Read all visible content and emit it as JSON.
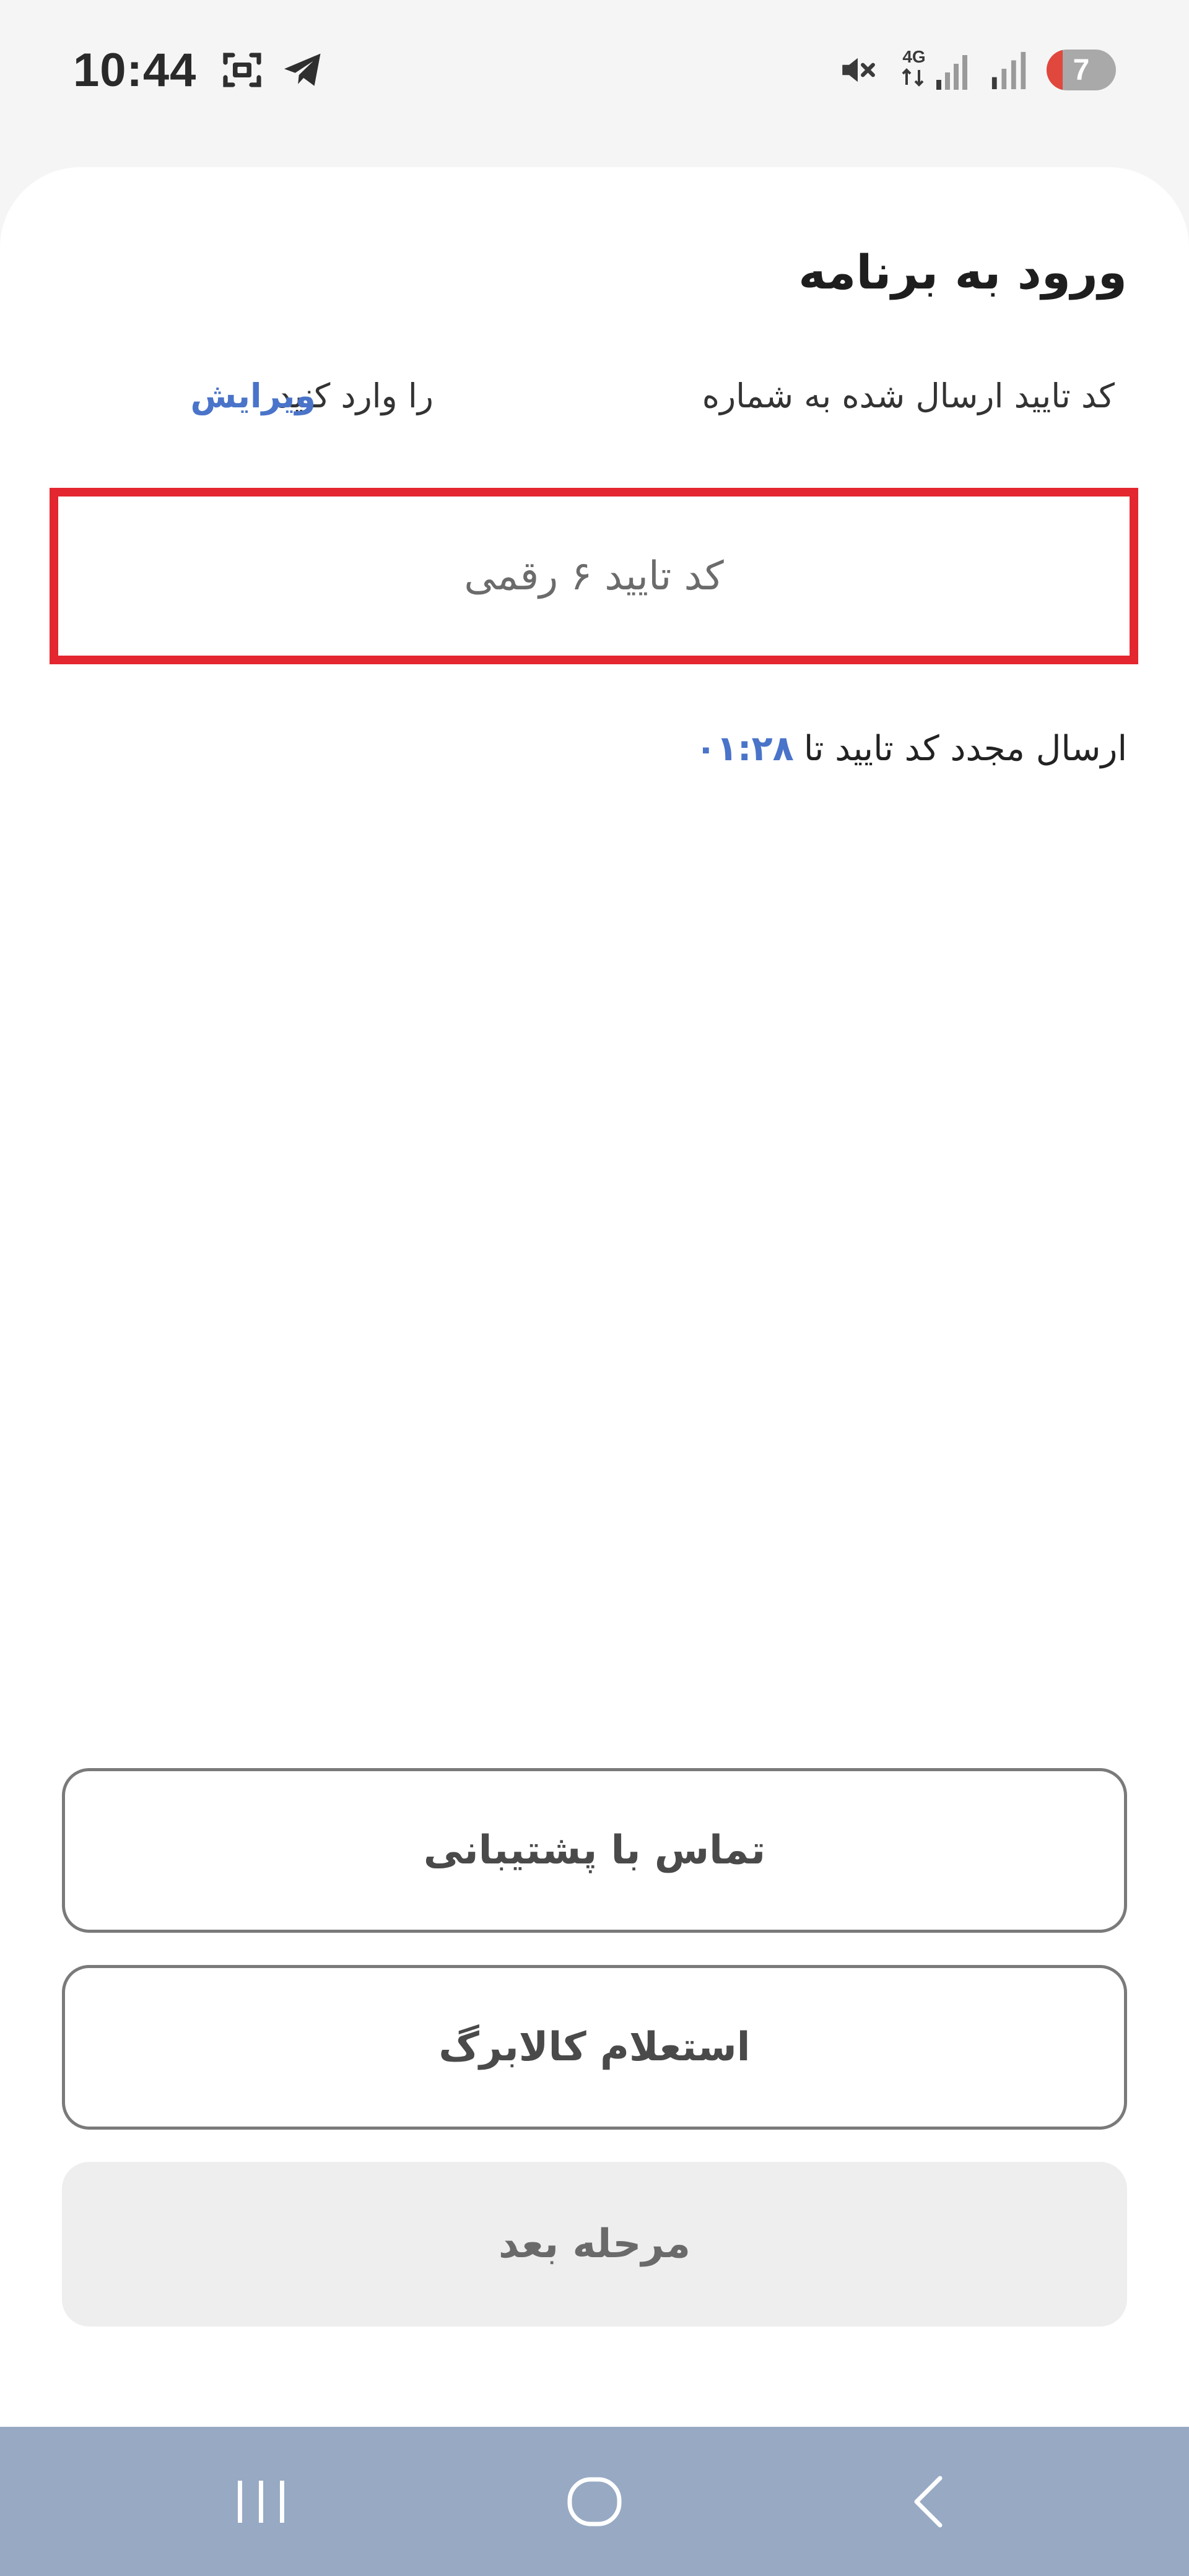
{
  "status_bar": {
    "time": "10:44",
    "network_type": "4G",
    "battery_level": "7",
    "icons": [
      "screenshot-icon",
      "telegram-icon",
      "mute-icon",
      "signal-icon",
      "battery-icon"
    ],
    "battery_low_color": "#e0483e"
  },
  "login": {
    "title": "ورود به برنامه",
    "subtitle_lead": "کد تایید ارسال شده به شماره",
    "phone_number": "",
    "subtitle_tail": "را وارد کنید",
    "edit_label": "ویرایش",
    "otp_placeholder": "کد تایید ۶ رقمی",
    "otp_value": "",
    "resend_label": "ارسال مجدد کد تایید تا",
    "resend_timer": "۰۱:۲۸"
  },
  "buttons": {
    "support": "تماس با پشتیبانی",
    "callback": "استعلام کالابرگ",
    "next": "مرحله بعد"
  },
  "nav_bar": {
    "items": [
      "recents-icon",
      "home-icon",
      "back-icon"
    ]
  },
  "colors": {
    "accent_link": "#4a74c9",
    "highlight_border": "#e3262f",
    "nav_bar": "#97a9c3"
  }
}
